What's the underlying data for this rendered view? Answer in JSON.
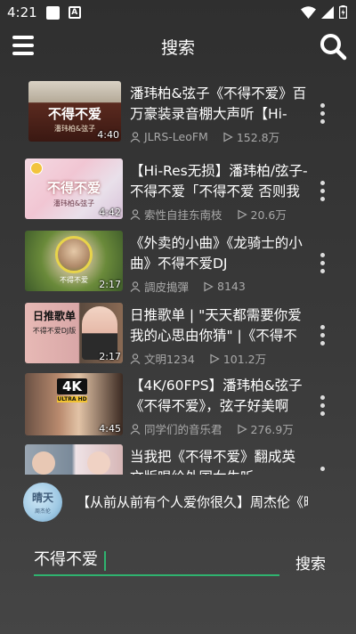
{
  "status_bar": {
    "time": "4:21"
  },
  "header": {
    "title": "搜索"
  },
  "results": [
    {
      "thumb_text": "不得不爱",
      "thumb_sub": "潘玮柏&弦子",
      "duration": "4:40",
      "title": "潘玮柏&弦子《不得不爱》百万豪装录音棚大声听【Hi-Res】",
      "uploader": "JLRS-LeoFM",
      "plays": "152.8万"
    },
    {
      "thumb_text": "不得不爱",
      "thumb_sub": "潘玮柏&弦子",
      "duration": "4:42",
      "title": "【Hi-Res无损】潘玮柏/弦子-不得不爱「不得不爱 否则我就无法呼吸」",
      "uploader": "索性自挂东南枝",
      "plays": "20.6万"
    },
    {
      "thumb_text": "不得不爱",
      "thumb_sub": "",
      "duration": "2:17",
      "title": "《外卖的小曲》《龙骑士的小曲》不得不爱DJ",
      "uploader": "調皮搗彈",
      "plays": "8143"
    },
    {
      "thumb_text": "日推歌单",
      "thumb_sub": "不得不爱DJ版",
      "duration": "2:17",
      "title": "日推歌单 | \"天天都需要你爱 我的心思由你猜\" |《不得不爱》DJ版",
      "uploader": "文明1234",
      "plays": "101.2万"
    },
    {
      "thumb_text": "4K",
      "thumb_sub": "ULTRA HD",
      "duration": "4:45",
      "title": "【4K/60FPS】潘玮柏&弦子《不得不爱》，弦子好美啊",
      "uploader": "同学们的音乐君",
      "plays": "276.9万"
    },
    {
      "thumb_text": "",
      "thumb_sub": "",
      "duration": "",
      "title": "当我把《不得不爱》翻成英文版唱给外国女生听",
      "uploader": "",
      "plays": ""
    }
  ],
  "player": {
    "avatar_text": "晴天",
    "avatar_sub": "周杰伦",
    "title": "【从前从前有个人爱你很久】周杰伦《晴天》"
  },
  "search": {
    "value": "不得不爱",
    "button_label": "搜索"
  },
  "colors": {
    "accent": "#2fb36f",
    "meta_text": "#a9a9a9"
  }
}
